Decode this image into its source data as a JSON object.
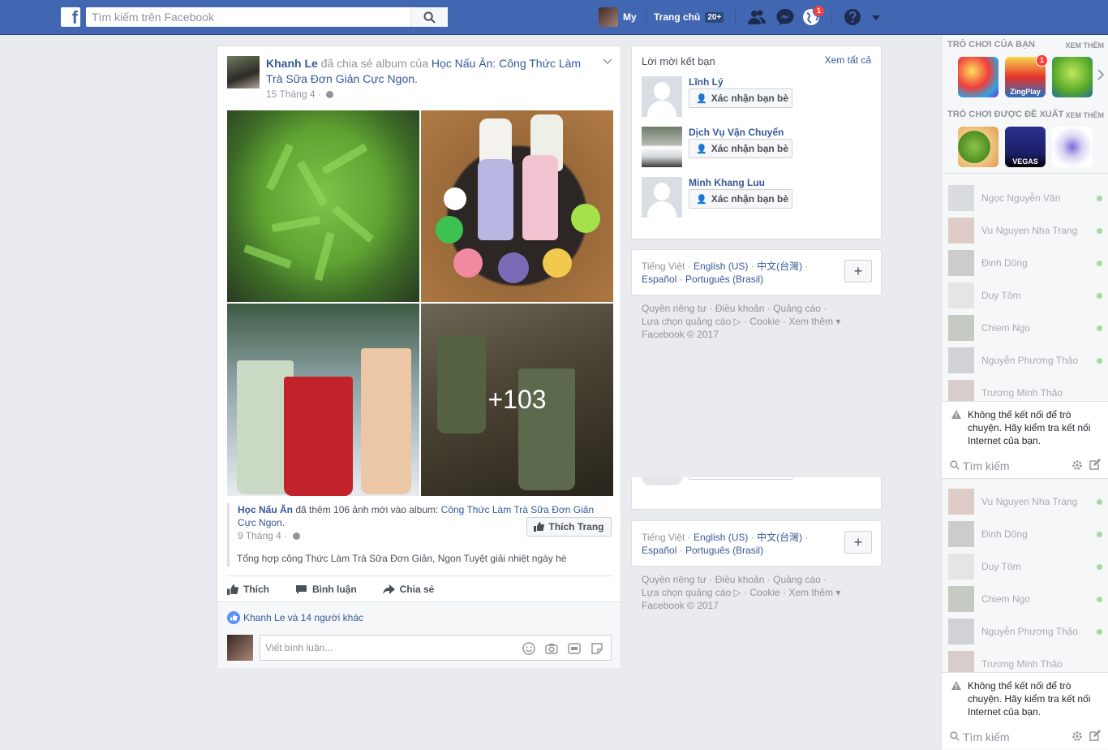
{
  "topbar": {
    "logo": "f",
    "search_placeholder": "Tìm kiếm trên Facebook",
    "profile_name": "My",
    "home_label": "Trang chủ",
    "home_badge": "20+",
    "notif_count": "1",
    "icons": [
      "friends-icon",
      "messenger-icon",
      "globe-notifications-icon",
      "help-icon",
      "caret-down-icon"
    ]
  },
  "post": {
    "author": "Khanh Le",
    "action_text": "đã chia sẻ album của",
    "album_link": "Học Nấu Ăn: Công Thức Làm Trà Sữa Đơn Giản Cực Ngon",
    "period": ".",
    "date": "15 Tháng 4 ·",
    "more_photos": "+103",
    "shared": {
      "page": "Học Nấu Ăn",
      "text": "đã thêm 106 ảnh mới vào album:",
      "album": "Công Thức Làm Trà Sữa Đơn Giản Cực Ngon",
      "period": ".",
      "date": "9 Tháng 4 ·",
      "like_page_label": "Thích Trang"
    },
    "description": "Tổng hợp công Thức Làm Trà Sữa Đơn Giản, Ngon Tuyệt giải nhiệt ngày hè",
    "actions": {
      "like": "Thích",
      "comment": "Bình luận",
      "share": "Chia sẻ"
    },
    "likes_text": "Khanh Le và 14 người khác",
    "comment_placeholder": "Viết bình luận..."
  },
  "friend_requests": {
    "title": "Lời mời kết bạn",
    "see_all": "Xem tất cả",
    "confirm_label": "Xác nhận bạn bè",
    "items": [
      {
        "name": "Lĩnh Lý"
      },
      {
        "name": "Dịch Vụ Vận Chuyển"
      },
      {
        "name": "Minh Khang Luu"
      }
    ]
  },
  "languages": {
    "current": "Tiếng Việt ·",
    "links": [
      "English (US)",
      "中文(台灣)",
      "Español",
      "Português (Brasil)"
    ],
    "sep": " · ",
    "plus": "+"
  },
  "footer": {
    "line1": "Quyền riêng tư · Điều khoản · Quảng cáo ·",
    "line2": "Lựa chọn quảng cáo ▷ · Cookie · Xem thêm ▾",
    "line3": "Facebook © 2017"
  },
  "sidebar": {
    "games_title": "TRÒ CHƠI CỦA BẠN",
    "games_more": "XEM THÊM",
    "suggested_title": "TRÒ CHƠI ĐƯỢC ĐỀ XUẤT",
    "suggested_more": "XEM THÊM",
    "game_badge": "1",
    "zingplay_label": "ZingPlay",
    "vegas_label": "VEGAS",
    "contacts": [
      "Ngọc Nguyễn Văn",
      "Vu Nguyen Nha Trang",
      "Đinh Dũng",
      "Duy Tôm",
      "Chiem Ngo",
      "Nguyễn Phương Thảo",
      "Trương Minh Thảo"
    ],
    "contacts2": [
      "Vu Nguyen Nha Trang",
      "Đinh Dũng",
      "Duy Tôm",
      "Chiem Ngo",
      "Nguyễn Phương Thảo",
      "Trương Minh Thảo"
    ],
    "warning": "Không thể kết nối để trò chuyện. Hãy kiểm tra kết nối Internet của bạn.",
    "chat_search_placeholder": "Tìm kiếm"
  }
}
